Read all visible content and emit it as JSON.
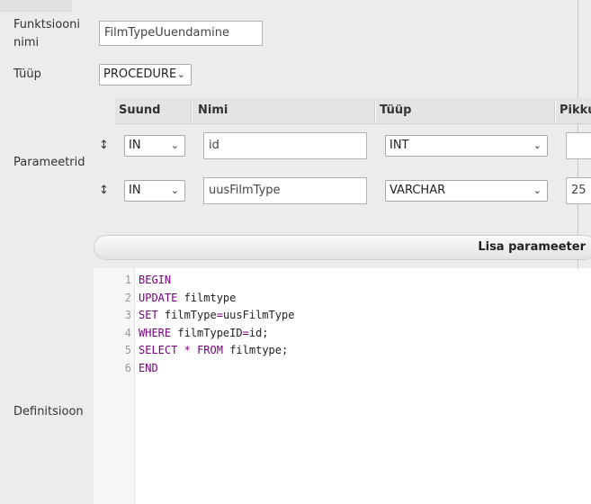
{
  "form": {
    "function_name": {
      "label_line1": "Funktsiooni",
      "label_line2": "nimi",
      "value": "FilmTypeUuendamine"
    },
    "type": {
      "label": "Tüüp",
      "selected": "PROCEDURE"
    },
    "parameters": {
      "label": "Parameetrid",
      "headers": {
        "direction": "Suund",
        "name": "Nimi",
        "type": "Tüüp",
        "length": "Pikku"
      },
      "rows": [
        {
          "direction": "IN",
          "name": "id",
          "type": "INT",
          "length": ""
        },
        {
          "direction": "IN",
          "name": "uusFilmType",
          "type": "VARCHAR",
          "length": "25"
        }
      ],
      "add_button": "Lisa parameeter",
      "drag_icon": "updown-arrow-icon"
    },
    "definition": {
      "label": "Definitsioon",
      "line_numbers": [
        "1",
        "2",
        "3",
        "4",
        "5",
        "6"
      ]
    }
  }
}
